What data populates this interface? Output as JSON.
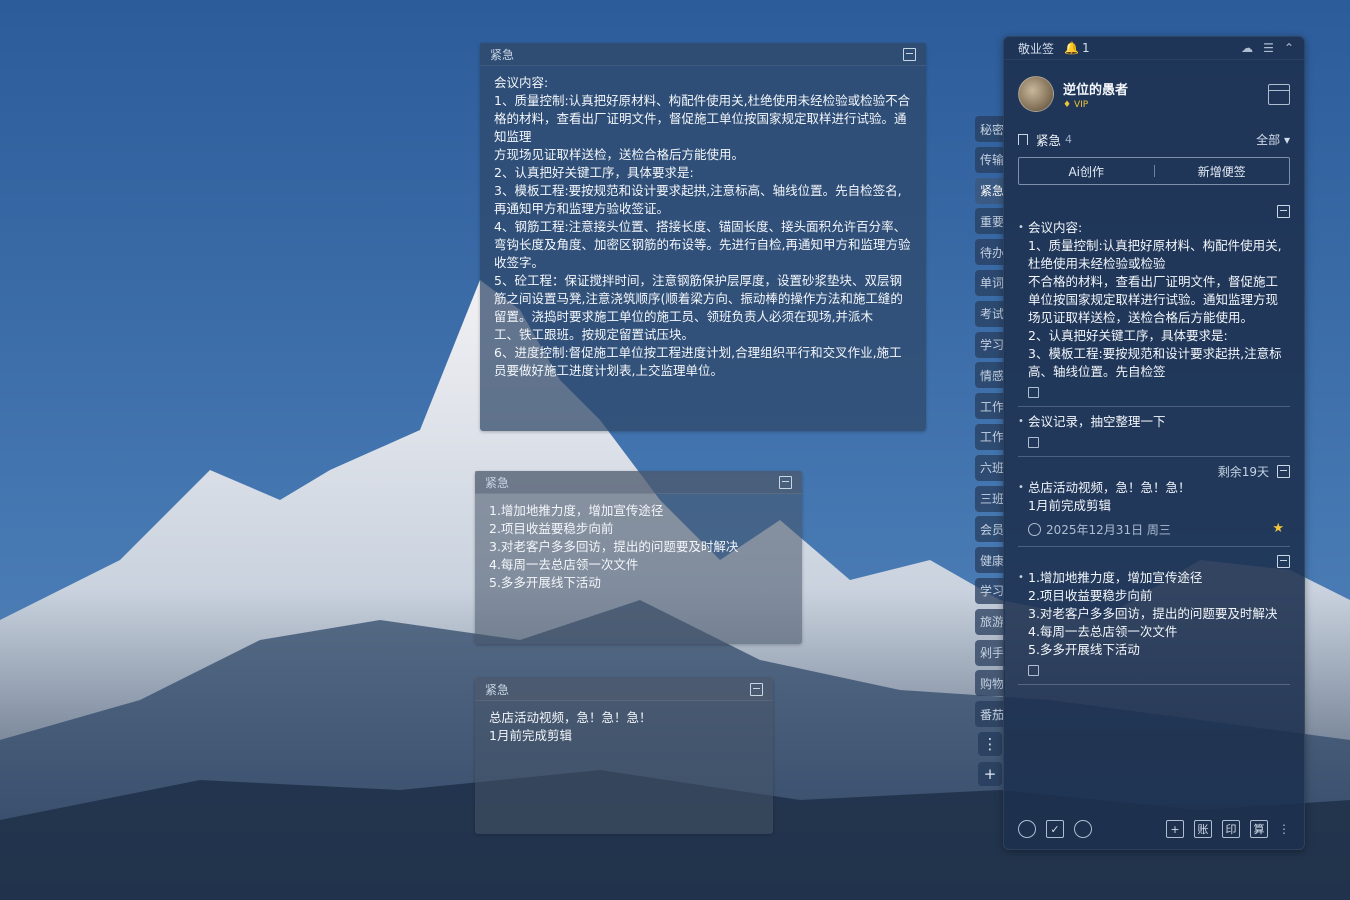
{
  "notes": [
    {
      "header": "紧急",
      "text": "会议内容:\n1、质量控制:认真把好原材料、构配件使用关,杜绝使用未经检验或检验不合格的材料，查看出厂证明文件，督促施工单位按国家规定取样进行试验。通知监理\n方现场见证取样送检，送检合格后方能使用。\n2、认真把好关键工序，具体要求是:\n3、模板工程:要按规范和设计要求起拱,注意标高、轴线位置。先自检签名,再通知甲方和监理方验收签证。\n4、钢筋工程:注意接头位置、搭接长度、锚固长度、接头面积允许百分率、弯钩长度及角度、加密区钢筋的布设等。先进行自检,再通知甲方和监理方验收签字。\n5、砼工程：保证搅拌时间，注意钢筋保护层厚度，设置砂浆垫块、双层钢筋之间设置马凳,注意浇筑顺序(顺着梁方向、振动棒的操作方法和施工缝的留置。浇捣时要求施工单位的施工员、领班负责人必须在现场,并派木\n工、铁工跟班。按规定留置试压块。\n6、进度控制:督促施工单位按工程进度计划,合理组织平行和交叉作业,施工员要做好施工进度计划表,上交监理单位。"
    },
    {
      "header": "紧急",
      "text": "1.增加地推力度，增加宣传途径\n2.项目收益要稳步向前\n3.对老客户多多回访，提出的问题要及时解决\n4.每周一去总店领一次文件\n5.多多开展线下活动"
    },
    {
      "header": "紧急",
      "text": "总店活动视频，急！急！急！\n1月前完成剪辑"
    }
  ],
  "side_tabs": [
    "秘密",
    "传输",
    "紧急",
    "重要",
    "待办",
    "单词",
    "考试",
    "学习",
    "情感",
    "工作",
    "工作",
    "六班",
    "三班",
    "会员",
    "健康",
    "学习",
    "旅游",
    "剁手",
    "购物",
    "番茄"
  ],
  "active_tab_index": 2,
  "side_buttons": {
    "more": "⋮",
    "add": "+"
  },
  "panel": {
    "app_name": "敬业签",
    "notify_count": "1",
    "user": {
      "name": "逆位的愚者",
      "badge": "VIP"
    },
    "category": {
      "name": "紧急",
      "count": "4",
      "filter": "全部 ▾"
    },
    "actions": {
      "ai": "Ai创作",
      "new": "新增便签"
    },
    "items": [
      {
        "text": "会议内容:\n1、质量控制:认真把好原材料、构配件使用关,杜绝使用未经检验或检验\n不合格的材料，查看出厂证明文件，督促施工单位按国家规定取样进行试验。通知监理方现场见证取样送检，送检合格后方能使用。\n2、认真把好关键工序，具体要求是:\n3、模板工程:要按规范和设计要求起拱,注意标高、轴线位置。先自检签\n名,再通知甲方和监理方验收签证。"
      },
      {
        "text": "会议记录，抽空整理一下"
      },
      {
        "meta": "剩余19天",
        "text": "总店活动视频，急！急！急！\n1月前完成剪辑",
        "date": "2025年12月31日 周三"
      },
      {
        "text": "1.增加地推力度，增加宣传途径\n2.项目收益要稳步向前\n3.对老客户多多回访，提出的问题要及时解决\n4.每周一去总店领一次文件\n5.多多开展线下活动"
      }
    ],
    "bottom_icons": {
      "account": "账",
      "print": "印",
      "calc": "算",
      "add": "+"
    }
  },
  "colors": {
    "star": "#f3c63a",
    "vip": "#f0c53b"
  }
}
